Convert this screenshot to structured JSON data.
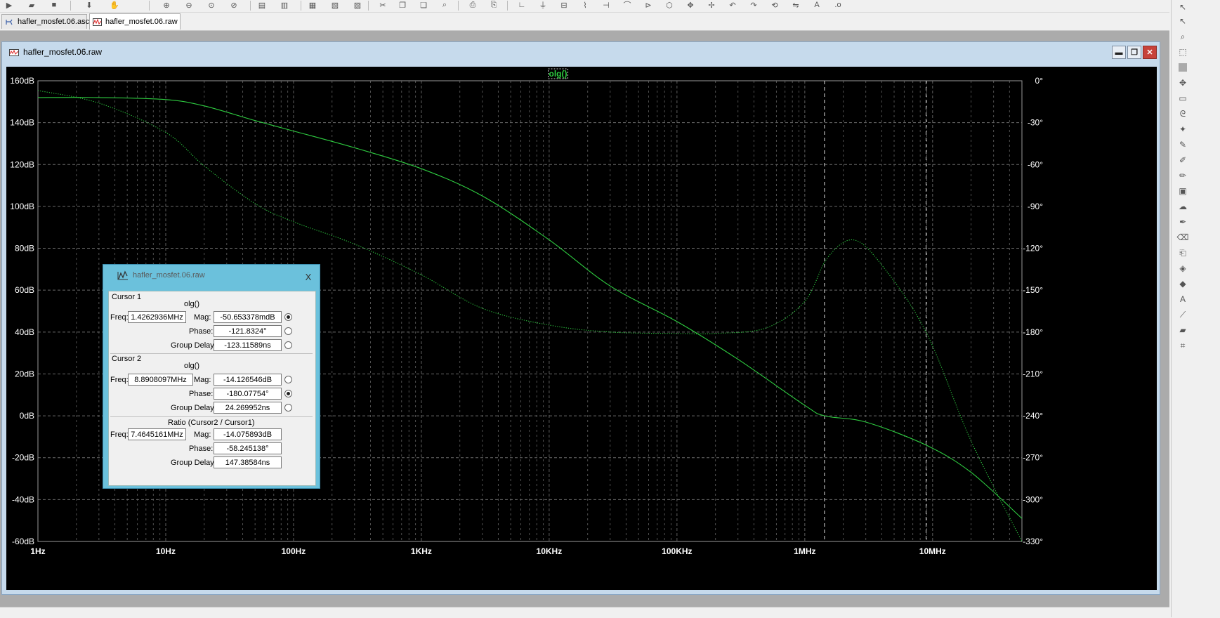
{
  "tabs": [
    {
      "label": "hafler_mosfet.06.asc",
      "active": false
    },
    {
      "label": "hafler_mosfet.06.raw",
      "active": true
    }
  ],
  "window": {
    "title": "hafler_mosfet.06.raw",
    "minimize_glyph": "▬",
    "maximize_glyph": "❐",
    "close_glyph": "✕"
  },
  "dialog": {
    "title": "hafler_mosfet.06.raw",
    "close_glyph": "X",
    "cursor1": {
      "header": "Cursor 1",
      "trace": "olg()",
      "freq_label": "Freq:",
      "freq": "1.4262936MHz",
      "mag_label": "Mag:",
      "mag": "-50.653378mdB",
      "phase_label": "Phase:",
      "phase": "-121.8324°",
      "gd_label": "Group Delay:",
      "gd": "-123.11589ns",
      "selected": "mag"
    },
    "cursor2": {
      "header": "Cursor 2",
      "trace": "olg()",
      "freq_label": "Freq:",
      "freq": "8.8908097MHz",
      "mag_label": "Mag:",
      "mag": "-14.126546dB",
      "phase_label": "Phase:",
      "phase": "-180.07754°",
      "gd_label": "Group Delay:",
      "gd": "24.269952ns",
      "selected": "phase"
    },
    "ratio": {
      "header": "Ratio (Cursor2 / Cursor1)",
      "freq_label": "Freq:",
      "freq": "7.4645161MHz",
      "mag_label": "Mag:",
      "mag": "-14.075893dB",
      "phase_label": "Phase:",
      "phase": "-58.245138°",
      "gd_label": "Group Delay:",
      "gd": "147.38584ns"
    }
  },
  "chart_data": {
    "type": "line",
    "title": "olg()",
    "xscale": "log",
    "xlim": [
      1,
      50000000
    ],
    "x_ticks": [
      "1Hz",
      "10Hz",
      "100Hz",
      "1KHz",
      "10KHz",
      "100KHz",
      "1MHz",
      "10MHz"
    ],
    "y_left_ticks": [
      "160dB",
      "140dB",
      "120dB",
      "100dB",
      "80dB",
      "60dB",
      "40dB",
      "20dB",
      "0dB",
      "-20dB",
      "-40dB",
      "-60dB"
    ],
    "y_right_ticks": [
      "0°",
      "-30°",
      "-60°",
      "-90°",
      "-120°",
      "-150°",
      "-180°",
      "-210°",
      "-240°",
      "-270°",
      "-300°",
      "-330°"
    ],
    "ylim_left": [
      -60,
      160
    ],
    "ylim_right": [
      -330,
      0
    ],
    "grid": true,
    "cursors_hz": [
      1426293.6,
      8890809.7
    ],
    "colors": {
      "trace": "#2ecc40",
      "grid": "#6a6a6a",
      "axis_text": "#ffffff",
      "background": "#000000"
    },
    "series": [
      {
        "name": "olg()",
        "axis": "left",
        "unit": "dB",
        "style": "solid",
        "x": [
          1,
          3,
          10,
          20,
          50,
          100,
          300,
          1000,
          3000,
          10000,
          30000,
          100000,
          300000,
          1000000,
          1426293.6,
          3000000,
          8890809.7,
          20000000,
          50000000
        ],
        "y": [
          152,
          152,
          151,
          148,
          141,
          136,
          128,
          118,
          105,
          84,
          62,
          45,
          27,
          5,
          0,
          -3,
          -14,
          -27,
          -49
        ]
      },
      {
        "name": "olg() phase",
        "axis": "right",
        "unit": "deg",
        "style": "dotted",
        "x": [
          1,
          3,
          10,
          20,
          50,
          100,
          300,
          1000,
          3000,
          10000,
          30000,
          100000,
          200000,
          500000,
          1000000,
          1500000,
          2400000,
          4000000,
          8890809.7,
          20000000,
          50000000
        ],
        "y": [
          -7,
          -16,
          -37,
          -61,
          -88,
          -101,
          -117,
          -139,
          -163,
          -175,
          -180,
          -181,
          -181,
          -177,
          -158,
          -127,
          -114,
          -132,
          -180,
          -258,
          -330
        ]
      }
    ]
  }
}
